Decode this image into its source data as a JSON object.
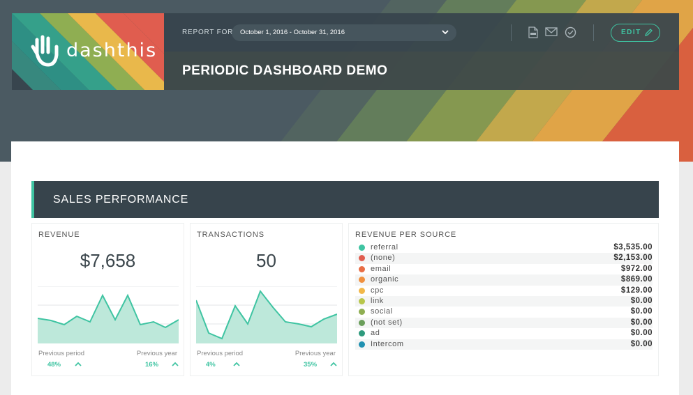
{
  "brand": {
    "name": "dashthis"
  },
  "header": {
    "report_for_label": "REPORT FOR",
    "date_range": "October 1, 2016 - October 31, 2016",
    "icons": [
      "pdf-icon",
      "mail-icon",
      "check-circle-icon"
    ],
    "edit_label": "EDIT",
    "title": "PERIODIC DASHBOARD DEMO"
  },
  "section": {
    "title": "SALES PERFORMANCE"
  },
  "cards": {
    "revenue": {
      "label": "REVENUE",
      "value": "$7,658",
      "previous_period_label": "Previous period",
      "previous_period_value": "48%",
      "previous_year_label": "Previous year",
      "previous_year_value": "16%"
    },
    "transactions": {
      "label": "TRANSACTIONS",
      "value": "50",
      "previous_period_label": "Previous period",
      "previous_period_value": "4%",
      "previous_year_label": "Previous year",
      "previous_year_value": "35%"
    },
    "revenue_per_source": {
      "label": "REVENUE PER SOURCE",
      "rows": [
        {
          "name": "referral",
          "value": "$3,535.00",
          "color": "#3fc4a2"
        },
        {
          "name": "(none)",
          "value": "$2,153.00",
          "color": "#e05d4f"
        },
        {
          "name": "email",
          "value": "$972.00",
          "color": "#e86d45"
        },
        {
          "name": "organic",
          "value": "$869.00",
          "color": "#f0903f"
        },
        {
          "name": "cpc",
          "value": "$129.00",
          "color": "#f2b84a"
        },
        {
          "name": "link",
          "value": "$0.00",
          "color": "#b7c64a"
        },
        {
          "name": "social",
          "value": "$0.00",
          "color": "#8fae52"
        },
        {
          "name": "(not set)",
          "value": "$0.00",
          "color": "#6a9e5a"
        },
        {
          "name": "ad",
          "value": "$0.00",
          "color": "#2e9a7d"
        },
        {
          "name": "Intercom",
          "value": "$0.00",
          "color": "#1f90b0"
        }
      ]
    }
  },
  "colors": {
    "accent": "#3fc4a2",
    "header_bg": "#37444c",
    "stripe_teal": "#35a08a",
    "stripe_green": "#8fae52",
    "stripe_yellow": "#e9b84b",
    "stripe_red": "#e05d4f"
  }
}
